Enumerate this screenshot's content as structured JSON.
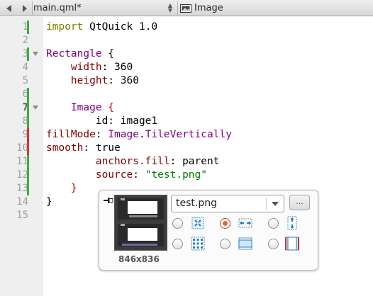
{
  "toolbar": {
    "back_icon": "left-triangle-icon",
    "forward_icon": "right-diamond-icon",
    "document_title": "main.qml*",
    "element_label": "Image",
    "element_icon": "image-frame-icon"
  },
  "gutter": {
    "line_numbers": [
      "1",
      "2",
      "3",
      "4",
      "5",
      "6",
      "7",
      "8",
      "9",
      "10",
      "11",
      "12",
      "13",
      "14",
      "15"
    ],
    "current_line": "7"
  },
  "code": {
    "lines": {
      "l1": {
        "kw": "import",
        "rest": " QtQuick 1.0"
      },
      "l3": {
        "type": "Rectangle",
        "rest": " {"
      },
      "l4": {
        "indent": "    ",
        "prop": "width",
        "rest": ": 360"
      },
      "l5": {
        "indent": "    ",
        "prop": "height",
        "rest": ": 360"
      },
      "l7": {
        "indent": "    ",
        "type": "Image",
        "rest": " {"
      },
      "l8": {
        "indent": "        ",
        "rest": "id: image1"
      },
      "l9": {
        "prop": "fillMode",
        "rest1": ": ",
        "type": "Image",
        "rest2": ".",
        "value": "TileVertically"
      },
      "l10": {
        "prop": "smooth",
        "rest": ": true"
      },
      "l11": {
        "indent": "        ",
        "prop": "anchors.fill",
        "rest": ": parent"
      },
      "l12": {
        "indent": "        ",
        "prop": "source",
        "rest": ": ",
        "str": "\"test.png\""
      },
      "l13": {
        "indent": "    ",
        "rest": "}"
      },
      "l14": {
        "rest": "}"
      }
    }
  },
  "popup": {
    "pin_icon": "pin-icon",
    "image_size": "846x836",
    "file_value": "test.png",
    "browse_label": "...",
    "fill_modes": [
      {
        "icon": "stretch-icon",
        "selected": false
      },
      {
        "icon": "tile-horizontally-icon",
        "selected": true
      },
      {
        "icon": "tile-vertically-icon",
        "selected": false
      },
      {
        "icon": "tile-icon",
        "selected": false
      },
      {
        "icon": "preserve-aspect-fit-icon",
        "selected": false
      },
      {
        "icon": "preserve-aspect-crop-icon",
        "selected": false
      }
    ]
  },
  "colors": {
    "keyword": "#808000",
    "type": "#800080",
    "property": "#800000",
    "string": "#008000",
    "modified_marker": "#3cae3c",
    "removed_marker": "#e23030",
    "selected_radio": "#ef5e33"
  }
}
